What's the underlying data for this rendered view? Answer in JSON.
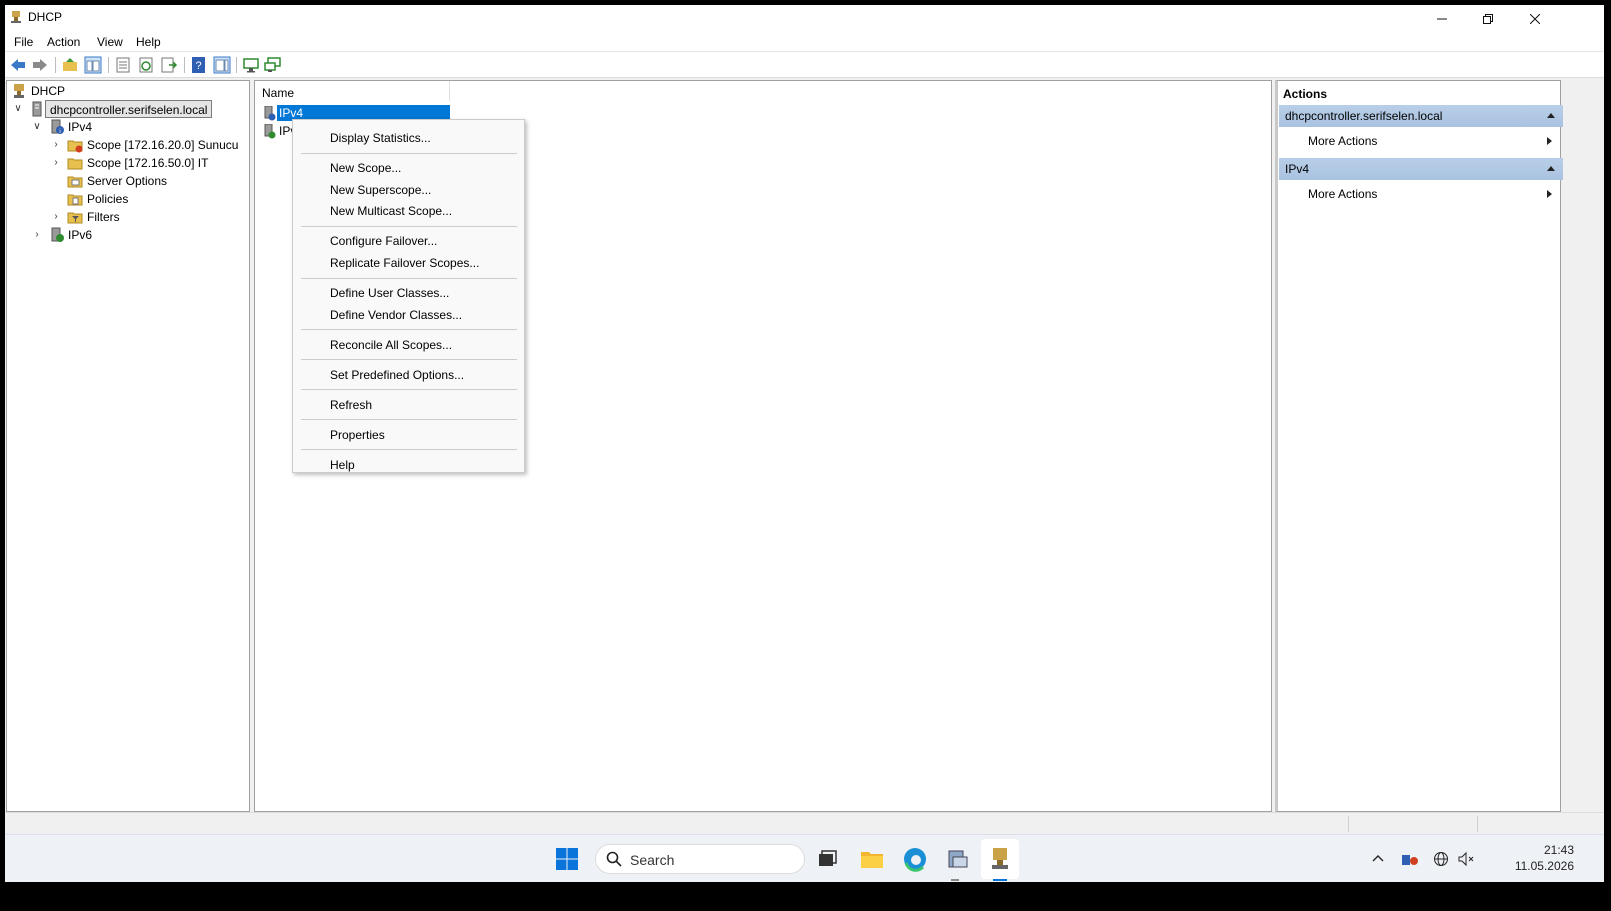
{
  "window": {
    "title": "DHCP"
  },
  "menu": [
    "File",
    "Action",
    "View",
    "Help"
  ],
  "tree": {
    "root": "DHCP",
    "server": "dhcpcontroller.serifselen.local",
    "ipv4": "IPv4",
    "scope1": "Scope [172.16.20.0] Sunucu",
    "scope2": "Scope [172.16.50.0] IT",
    "server_options": "Server Options",
    "policies": "Policies",
    "filters": "Filters",
    "ipv6": "IPv6"
  },
  "list": {
    "column_name": "Name",
    "items": [
      "IPv4",
      "IPv"
    ]
  },
  "context_menu": {
    "display_statistics": "Display Statistics...",
    "new_scope": "New Scope...",
    "new_superscope": "New Superscope...",
    "new_multicast_scope": "New Multicast Scope...",
    "configure_failover": "Configure Failover...",
    "replicate_failover": "Replicate Failover Scopes...",
    "define_user_classes": "Define User Classes...",
    "define_vendor_classes": "Define Vendor Classes...",
    "reconcile": "Reconcile All Scopes...",
    "set_predefined": "Set Predefined Options...",
    "refresh": "Refresh",
    "properties": "Properties",
    "help": "Help"
  },
  "actions": {
    "title": "Actions",
    "section1": "dhcpcontroller.serifselen.local",
    "section1_more": "More Actions",
    "section2": "IPv4",
    "section2_more": "More Actions"
  },
  "taskbar": {
    "search_placeholder": "Search",
    "time": "21:43",
    "date": "11.05.2026"
  },
  "colors": {
    "selection": "#0078d7",
    "action_header": "#b4cbe6"
  }
}
